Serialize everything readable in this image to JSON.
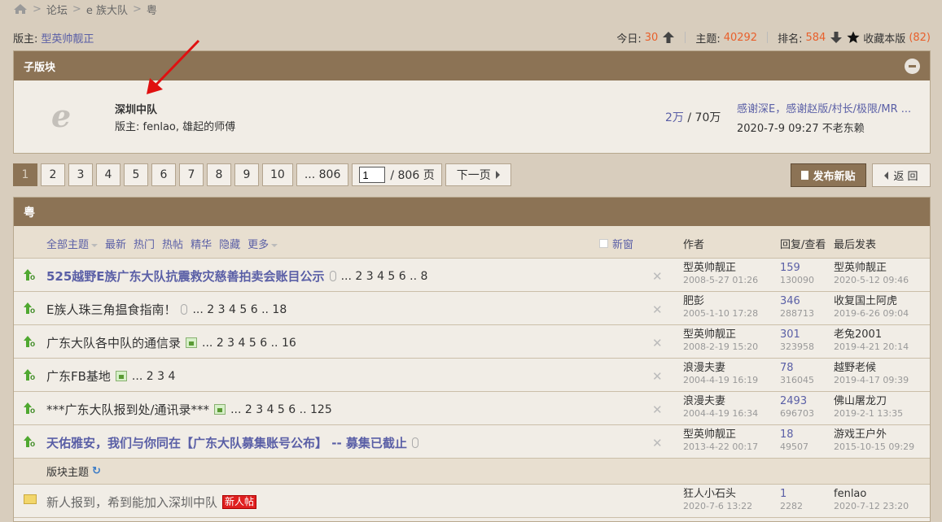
{
  "breadcrumb": {
    "items": [
      "论坛",
      "e 族大队",
      "粤"
    ],
    "sep": ">"
  },
  "moderator_bar": {
    "label": "版主:",
    "moderators": "型英帅靓正",
    "today_label": "今日:",
    "today_value": "30",
    "topics_label": "主题:",
    "topics_value": "40292",
    "rank_label": "排名:",
    "rank_value": "584",
    "favorite_label": "收藏本版",
    "favorite_count": "(82)"
  },
  "subforum_box": {
    "header": "子版块",
    "logo_letter": "e",
    "name": "深圳中队",
    "moderators": "版主: fenlao, 雄起的师傅",
    "count_a": "2万",
    "count_sep": " / ",
    "count_b": "70万",
    "last_title": "感谢深E，感谢赵版/村长/极限/MR ...",
    "last_info": "2020-7-9 09:27 不老东赖"
  },
  "pager": {
    "pages": [
      "1",
      "2",
      "3",
      "4",
      "5",
      "6",
      "7",
      "8",
      "9",
      "10",
      "... 806"
    ],
    "current": "1",
    "jump_value": "1",
    "jump_total": "/ 806 页",
    "next_label": "下一页",
    "post_button": "发布新贴",
    "back_button": "返 回"
  },
  "thread_list": {
    "header": "粤",
    "tabs": [
      "全部主题",
      "最新",
      "热门",
      "热帖",
      "精华",
      "隐藏",
      "更多"
    ],
    "new_window": "新窗",
    "col_author": "作者",
    "col_reply": "回复/查看",
    "col_last": "最后发表",
    "sticky_rows": [
      {
        "title": "525越野E族广东大队抗震救灾慈善拍卖会账目公示",
        "pages": "... 2  3  4  5  6 .. 8",
        "author": "型英帅靓正",
        "author_date": "2008-5-27 01:26",
        "replies": "159",
        "views": "130090",
        "last_user": "型英帅靓正",
        "last_date": "2020-5-12 09:46"
      },
      {
        "title": "E族人珠三角揾食指南！",
        "pages": "... 2  3  4  5  6 .. 18",
        "author": "肥彭",
        "author_date": "2005-1-10 17:28",
        "replies": "346",
        "views": "288713",
        "last_user": "收复国土阿虎",
        "last_date": "2019-6-26 09:04"
      },
      {
        "title": "广东大队各中队的通信录",
        "pages": "... 2  3  4  5  6 .. 16",
        "author": "型英帅靓正",
        "author_date": "2008-2-19 15:20",
        "replies": "301",
        "views": "323958",
        "last_user": "老兔2001",
        "last_date": "2019-4-21 20:14"
      },
      {
        "title": "广东FB基地",
        "pages": "... 2  3  4",
        "author": "浪漫夫妻",
        "author_date": "2004-4-19 16:19",
        "replies": "78",
        "views": "316045",
        "last_user": "越野老候",
        "last_date": "2019-4-17 09:39"
      },
      {
        "title": "***广东大队报到处/通讯录***",
        "pages": "... 2  3  4  5  6 .. 125",
        "author": "浪漫夫妻",
        "author_date": "2004-4-19 16:34",
        "replies": "2493",
        "views": "696703",
        "last_user": "佛山屠龙刀",
        "last_date": "2019-2-1 13:35"
      },
      {
        "title": "天佑雅安，我们与你同在【广东大队募集账号公布】 -- 募集已截止",
        "pages": "",
        "author": "型英帅靓正",
        "author_date": "2013-4-22 00:17",
        "replies": "18",
        "views": "49507",
        "last_user": "游戏王户外",
        "last_date": "2015-10-15 09:29"
      }
    ],
    "section_label": "版块主题",
    "normal_rows": [
      {
        "title": "新人报到，希到能加入深圳中队",
        "badge": "新人帖",
        "author": "狂人小石头",
        "author_date": "2020-7-6 13:22",
        "replies": "1",
        "views": "2282",
        "last_user": "fenlao",
        "last_date": "2020-7-12 23:20"
      }
    ]
  },
  "colors": {
    "header_brown": "#8c7355",
    "link": "#5a5fa6",
    "accent": "#e8602c"
  }
}
